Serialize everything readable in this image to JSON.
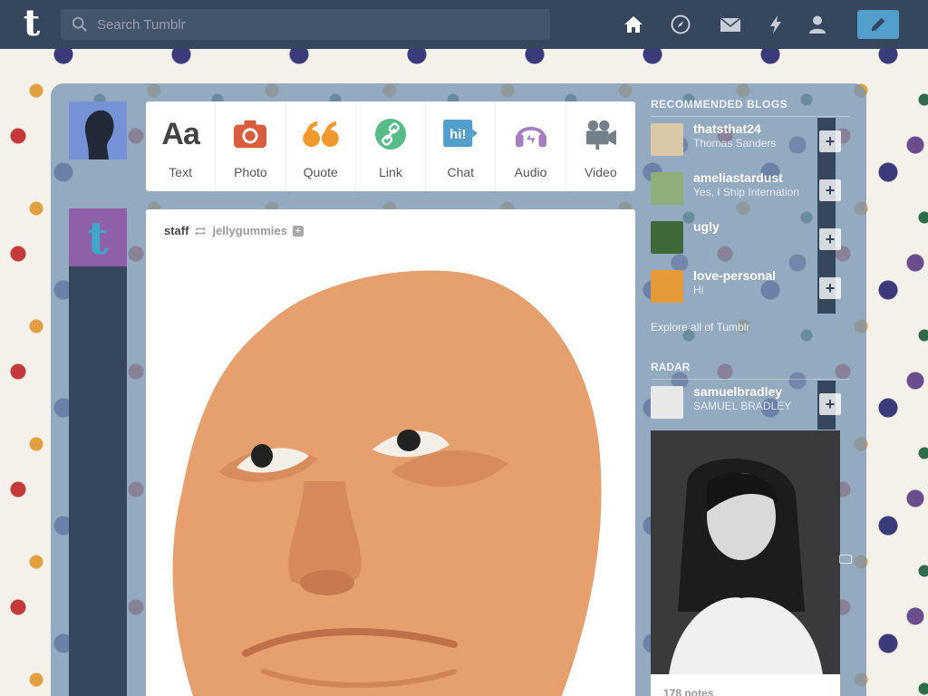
{
  "header": {
    "logo": "t",
    "search_placeholder": "Search Tumblr",
    "nav": [
      "home-icon",
      "compass-icon",
      "mail-icon",
      "lightning-icon",
      "account-icon"
    ],
    "compose_icon": "pencil-icon"
  },
  "post_types": [
    {
      "label": "Text",
      "icon": "text-icon",
      "glyph": "Aa",
      "color": "#444444"
    },
    {
      "label": "Photo",
      "icon": "camera-icon",
      "color": "#d95e40"
    },
    {
      "label": "Quote",
      "icon": "quote-icon",
      "color": "#f2992e"
    },
    {
      "label": "Link",
      "icon": "link-icon",
      "color": "#56bc8a"
    },
    {
      "label": "Chat",
      "icon": "chat-icon",
      "glyph": "hi!",
      "color": "#529ecc"
    },
    {
      "label": "Audio",
      "icon": "headphones-icon",
      "color": "#a77dc2"
    },
    {
      "label": "Video",
      "icon": "video-camera-icon",
      "color": "#748089"
    }
  ],
  "post": {
    "author": "staff",
    "reblogged_from": "jellygummies",
    "plus": "+"
  },
  "sidebar": {
    "recommended_title": "RECOMMENDED BLOGS",
    "recommended": [
      {
        "name": "thatsthat24",
        "sub": "Thomas Sanders"
      },
      {
        "name": "ameliastardust",
        "sub": "Yes, I Ship Internation"
      },
      {
        "name": "ugly",
        "sub": ""
      },
      {
        "name": "love-personal",
        "sub": "Hi"
      }
    ],
    "follow_label": "+",
    "explore": "Explore all of Tumblr",
    "radar_title": "RADAR",
    "radar": {
      "name": "samuelbradley",
      "sub": "SAMUEL BRADLEY",
      "notes": "178 notes"
    }
  },
  "colors": {
    "navy": "#36465d",
    "accent": "#529ecc"
  }
}
